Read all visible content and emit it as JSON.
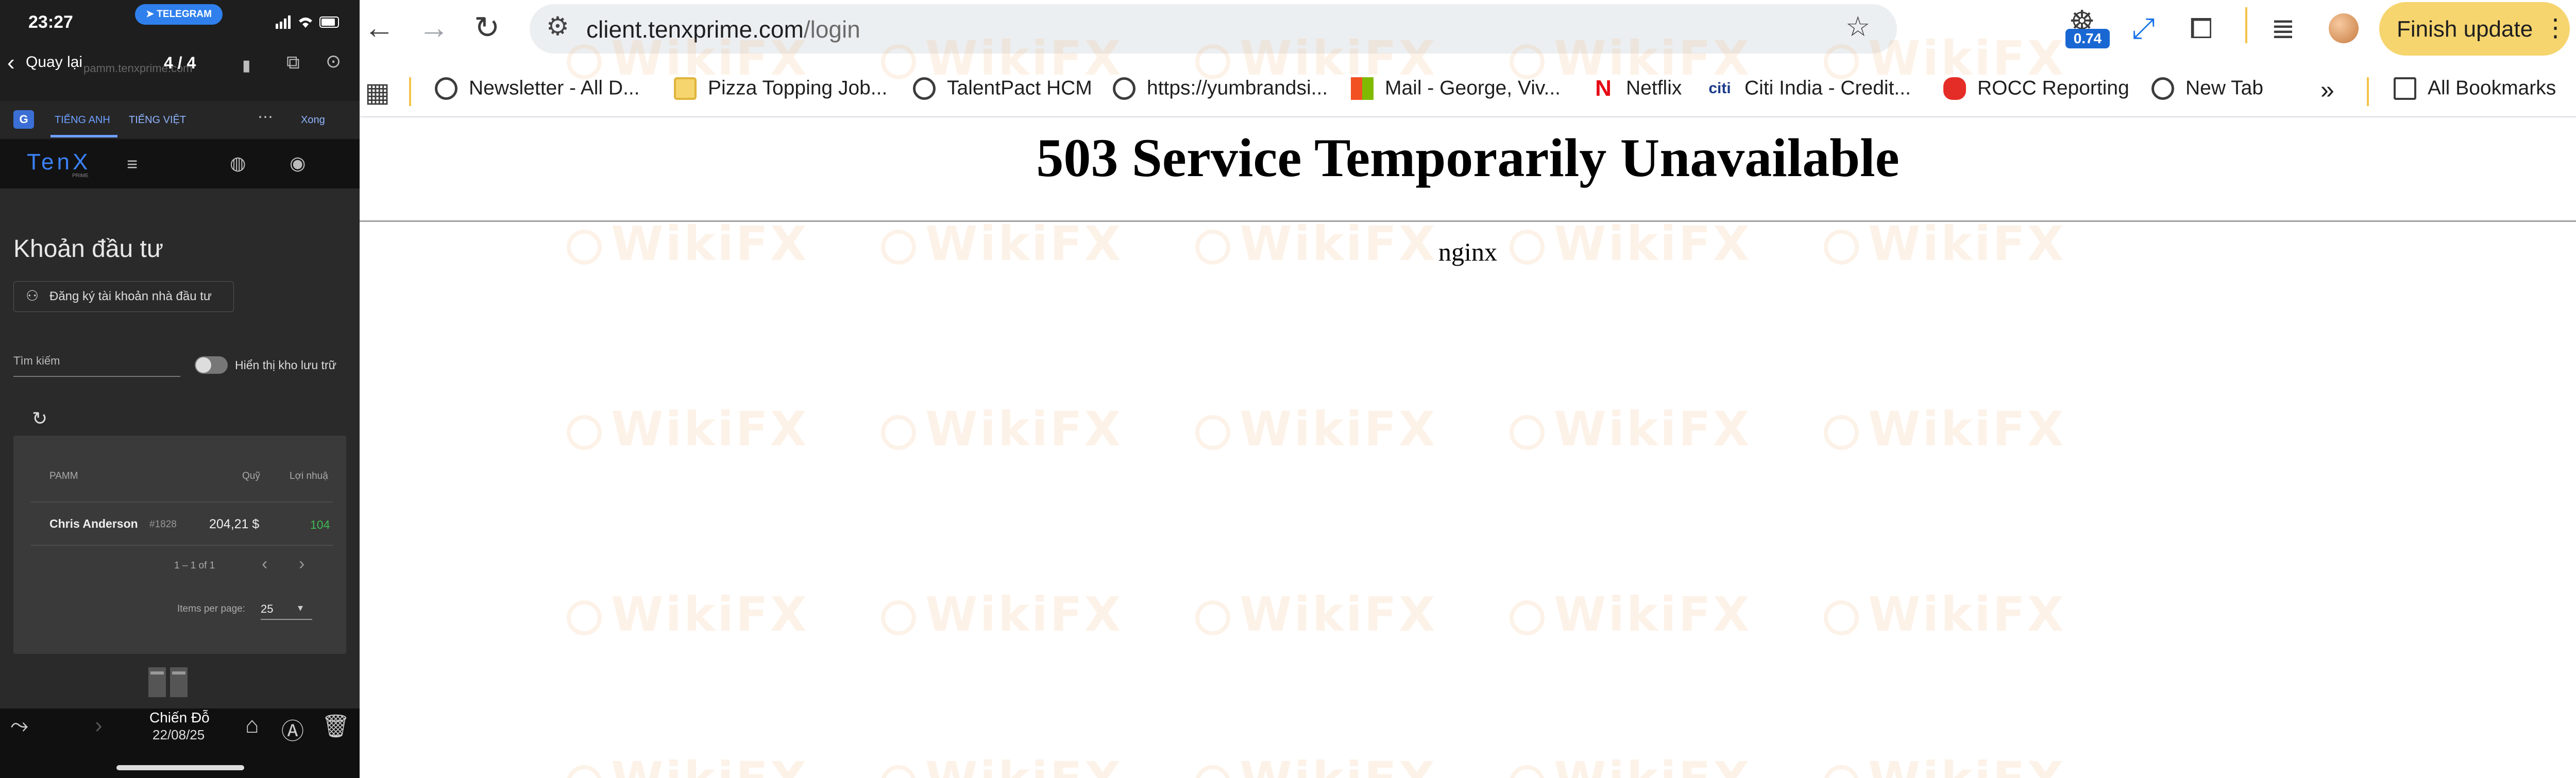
{
  "phone": {
    "status": {
      "time": "23:27",
      "pill": "TELEGRAM"
    },
    "header": {
      "back_label": "Quay lại",
      "url": "pamm.tenxprime.com",
      "page_count": "4 / 4"
    },
    "translate_bar": {
      "tab_english": "TIẾNG ANH",
      "tab_vietnamese": "TIẾNG VIỆT",
      "done": "Xong"
    },
    "app": {
      "logo": "TenX",
      "logo_sub": "PRIME",
      "section_title": "Khoản đầu tư",
      "register_button": "Đăng ký tài khoản nhà đầu tư",
      "search_placeholder": "Tìm kiếm",
      "archive_toggle_label": "Hiển thị kho lưu trữ",
      "table": {
        "headers": [
          "PAMM",
          "Quỹ",
          "Lợi nhuậ"
        ],
        "rows": [
          {
            "name": "Chris Anderson",
            "id": "#1828",
            "fund": "204,21 $",
            "profit": "104"
          }
        ]
      },
      "pagination": {
        "range": "1 – 1 of 1",
        "items_per_page_label": "Items per page:",
        "items_per_page": "25"
      }
    },
    "bottom": {
      "name": "Chiến Đỗ",
      "date": "22/08/25"
    }
  },
  "browser": {
    "url": {
      "host": "client.tenxprime.com",
      "path": "/login"
    },
    "extension_badge": "0.74",
    "update_button": "Finish update",
    "bookmarks": [
      {
        "label": "Newsletter - All D...",
        "icon": "globe-icon"
      },
      {
        "label": "Pizza Topping Job...",
        "icon": "folder-icon"
      },
      {
        "label": "TalentPact HCM",
        "icon": "globe-icon"
      },
      {
        "label": "https://yumbrandsi...",
        "icon": "globe-icon"
      },
      {
        "label": "Mail - George, Viv...",
        "icon": "microsoft-icon"
      },
      {
        "label": "Netflix",
        "icon": "netflix-icon"
      },
      {
        "label": "Citi India - Credit...",
        "icon": "citi-icon"
      },
      {
        "label": "ROCC Reporting",
        "icon": "rocc-icon"
      },
      {
        "label": "New Tab",
        "icon": "globe-icon"
      }
    ],
    "all_bookmarks": "All Bookmarks",
    "page": {
      "title": "503 Service Temporarily Unavailable",
      "server": "nginx"
    }
  },
  "watermark": "WikiFX",
  "colors": {
    "accent_blue": "#1967d2",
    "update_yellow": "#f6d56f",
    "profit_green": "#3fb950",
    "watermark": "#f0af6e"
  }
}
